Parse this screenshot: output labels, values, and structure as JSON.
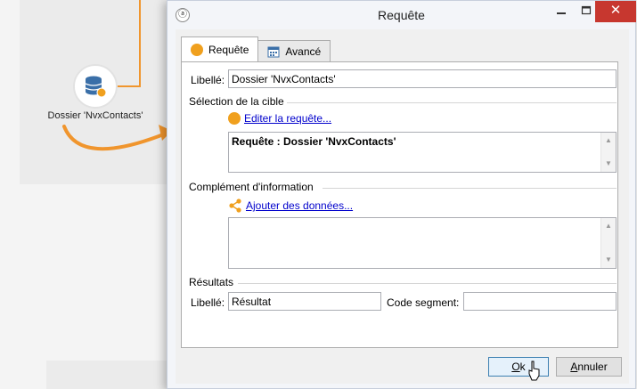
{
  "canvas": {
    "node_label": "Dossier 'NvxContacts'",
    "node_icon": "database-query-icon",
    "accent": "#f0952d"
  },
  "dialog": {
    "title": "Requête",
    "window_buttons": {
      "minimize": "▬",
      "maximize": "□",
      "close": "✕"
    },
    "tabs": [
      {
        "label": "Requête",
        "icon": "orange-circle-icon"
      },
      {
        "label": "Avancé",
        "icon": "calendar-icon"
      }
    ],
    "libelle_label": "Libellé:",
    "libelle_value": "Dossier 'NvxContacts'",
    "cible": {
      "title": "Sélection de la cible",
      "link": "Editer la requête...",
      "query_text": "Requête : Dossier 'NvxContacts'"
    },
    "complement": {
      "title": "Complément d'information",
      "link": "Ajouter des données..."
    },
    "resultats": {
      "title": "Résultats",
      "libelle_label": "Libellé:",
      "libelle_value": "Résultat",
      "code_segment_label": "Code segment:",
      "code_segment_value": ""
    },
    "buttons": {
      "ok": {
        "accel": "O",
        "rest": "k"
      },
      "cancel": {
        "accel": "A",
        "rest": "nnuler"
      }
    },
    "colors": {
      "orange": "#f0a01e",
      "close_red": "#c7372f",
      "link_blue": "#0000cc"
    }
  }
}
